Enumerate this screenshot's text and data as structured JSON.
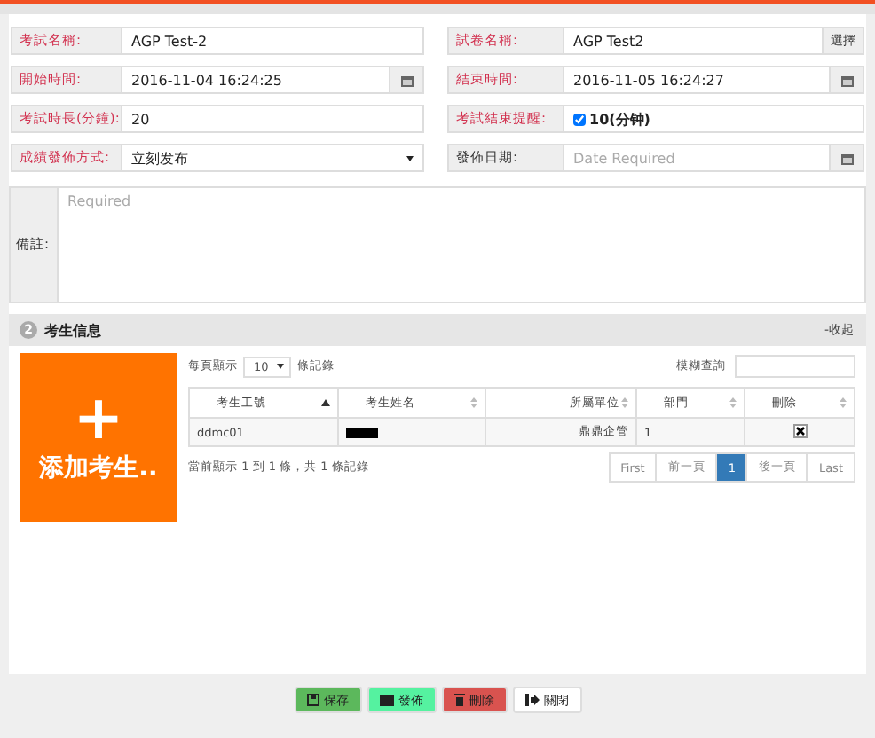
{
  "form": {
    "fields": [
      {
        "label": "考試名稱:",
        "required": true,
        "kind": "text",
        "value": "AGP Test-2"
      },
      {
        "label": "試卷名稱:",
        "required": true,
        "kind": "picker",
        "value": "AGP Test2",
        "button": "選擇"
      },
      {
        "label": "開始時間:",
        "required": true,
        "kind": "date",
        "value": "2016-11-04 16:24:25"
      },
      {
        "label": "結束時間:",
        "required": true,
        "kind": "date",
        "value": "2016-11-05 16:24:27"
      },
      {
        "label": "考試時長(分鐘):",
        "required": true,
        "kind": "text",
        "value": "20"
      },
      {
        "label": "考試結束提醒:",
        "required": true,
        "kind": "checkbox",
        "checked": true,
        "value": "10(分钟)"
      },
      {
        "label": "成績發佈方式:",
        "required": true,
        "kind": "select",
        "value": "立刻发布"
      },
      {
        "label": "發佈日期:",
        "required": false,
        "kind": "date",
        "placeholder": "Date Required"
      }
    ],
    "remark": {
      "label": "備註:",
      "placeholder": "Required"
    }
  },
  "section": {
    "number": "2",
    "title": "考生信息",
    "toggle": "-收起",
    "add_button": {
      "icon": "+",
      "text": "添加考生.."
    },
    "page_size": {
      "before": "每頁顯示",
      "value": "10",
      "after": "條記錄"
    },
    "search": {
      "label": "模糊查詢"
    },
    "table": {
      "columns": [
        {
          "label": "考生工號",
          "sorted": true,
          "align_right": false
        },
        {
          "label": "考生姓名",
          "sorted": false,
          "align_right": false
        },
        {
          "label": "所屬單位",
          "sorted": false,
          "align_right": true
        },
        {
          "label": "部門",
          "sorted": false,
          "align_right": false
        },
        {
          "label": "刪除",
          "sorted": false,
          "align_right": false
        }
      ],
      "rows": [
        {
          "id": "ddmc01",
          "name_redacted": true,
          "unit": "鼎鼎企管",
          "dept": "1"
        }
      ]
    },
    "info": "當前顯示 1 到 1 條，共 1 條記錄",
    "pagination": [
      {
        "label": "First",
        "selected": false
      },
      {
        "label": "前一頁",
        "selected": false
      },
      {
        "label": "1",
        "selected": true
      },
      {
        "label": "後一頁",
        "selected": false
      },
      {
        "label": "Last",
        "selected": false
      }
    ]
  },
  "buttons": [
    {
      "kind": "save",
      "label": "保存"
    },
    {
      "kind": "publish",
      "label": "發佈"
    },
    {
      "kind": "delete",
      "label": "刪除"
    },
    {
      "kind": "close",
      "label": "關閉"
    }
  ]
}
